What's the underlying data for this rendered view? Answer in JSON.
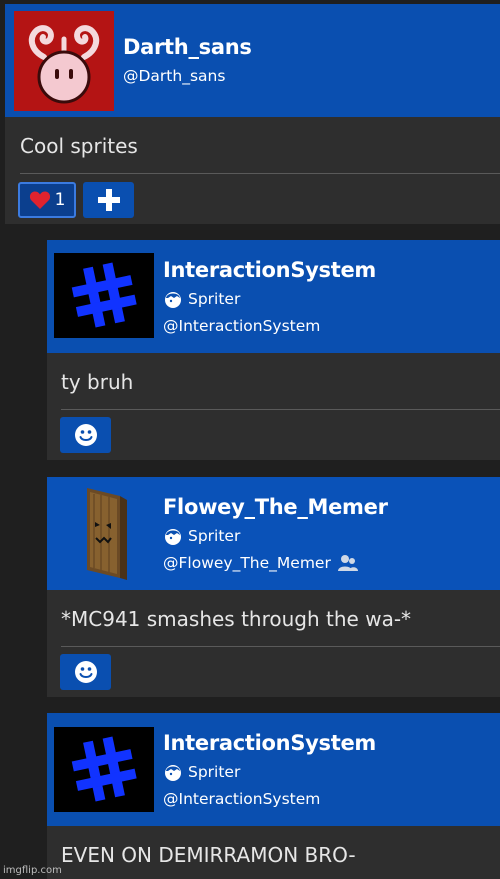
{
  "posts": [
    {
      "username": "Darth_sans",
      "handle": "@Darth_sans",
      "content": "Cool sprites",
      "likes": "1"
    },
    {
      "username": "InteractionSystem",
      "rank": "Spriter",
      "handle": "@InteractionSystem",
      "content": "ty bruh"
    },
    {
      "username": "Flowey_The_Memer",
      "rank": "Spriter",
      "handle": "@Flowey_The_Memer",
      "content": "*MC941 smashes through the wa-*"
    },
    {
      "username": "InteractionSystem",
      "rank": "Spriter",
      "handle": "@InteractionSystem",
      "content": "EVEN ON DEMIRRAMON BRO-"
    }
  ],
  "watermark": "imgflip.com",
  "icons": {
    "like": "heart-icon",
    "add": "plus-icon",
    "react": "smiley-icon",
    "rank": "spriter-rank-icon",
    "follow": "user-follow-icon"
  },
  "colors": {
    "header": "#0a4fb0",
    "body": "#2e2e2e",
    "page": "#1f1f1f",
    "heart": "#e0232e"
  }
}
